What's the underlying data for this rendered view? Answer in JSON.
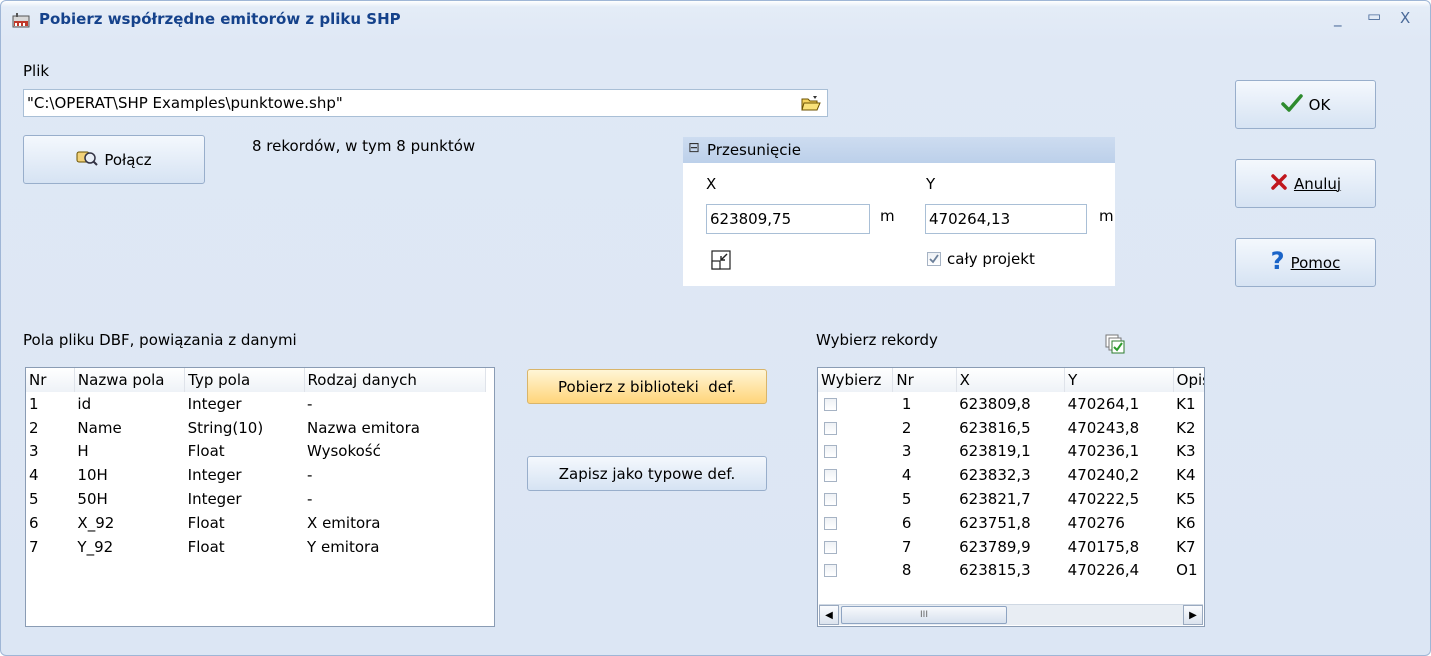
{
  "window": {
    "title": "Pobierz współrzędne emitorów z pliku SHP",
    "minimize_glyph": "_",
    "maximize_glyph": "▭",
    "close_glyph": "X"
  },
  "file": {
    "label": "Plik",
    "value": "\"C:\\OPERAT\\SHP Examples\\punktowe.shp\"",
    "browse_icon": "folder-open-icon"
  },
  "connect": {
    "label": "Połącz",
    "icon": "connect-icon",
    "status": "8 rekordów, w tym 8 punktów"
  },
  "offset": {
    "title": "Przesunięcie",
    "collapse_glyph": "⊟",
    "x_label": "X",
    "y_label": "Y",
    "x_value": "623809,75",
    "y_value": "470264,13",
    "x_unit": "m",
    "y_unit": "m",
    "whole_project_label": "cały projekt",
    "whole_project_checked": true
  },
  "actions": {
    "ok": "OK",
    "cancel": "Anuluj",
    "help": "Pomoc"
  },
  "dbf": {
    "label": "Pola pliku DBF, powiązania z danymi",
    "columns": [
      "Nr",
      "Nazwa pola",
      "Typ pola",
      "Rodzaj danych"
    ],
    "rows": [
      [
        "1",
        "id",
        "Integer",
        "-"
      ],
      [
        "2",
        "Name",
        "String(10)",
        "Nazwa emitora"
      ],
      [
        "3",
        "H",
        "Float",
        "Wysokość"
      ],
      [
        "4",
        "10H",
        "Integer",
        "-"
      ],
      [
        "5",
        "50H",
        "Integer",
        "-"
      ],
      [
        "6",
        "X_92",
        "Float",
        "X emitora"
      ],
      [
        "7",
        "Y_92",
        "Float",
        "Y emitora"
      ]
    ]
  },
  "middle_buttons": {
    "load_library": "Pobierz z biblioteki  def.",
    "save_default": "Zapisz jako typowe def."
  },
  "records": {
    "label": "Wybierz rekordy",
    "select_all_icon": "select-all-icon",
    "columns": [
      "Wybierz",
      "Nr",
      "X",
      "Y",
      "Opis,"
    ],
    "rows": [
      [
        "1",
        "623809,8",
        "470264,1",
        "K1"
      ],
      [
        "2",
        "623816,5",
        "470243,8",
        "K2"
      ],
      [
        "3",
        "623819,1",
        "470236,1",
        "K3"
      ],
      [
        "4",
        "623832,3",
        "470240,2",
        "K4"
      ],
      [
        "5",
        "623821,7",
        "470222,5",
        "K5"
      ],
      [
        "6",
        "623751,8",
        "470276",
        "K6"
      ],
      [
        "7",
        "623789,9",
        "470175,8",
        "K7"
      ],
      [
        "8",
        "623815,3",
        "470226,4",
        "O1"
      ]
    ],
    "scroll_grip": "III"
  }
}
